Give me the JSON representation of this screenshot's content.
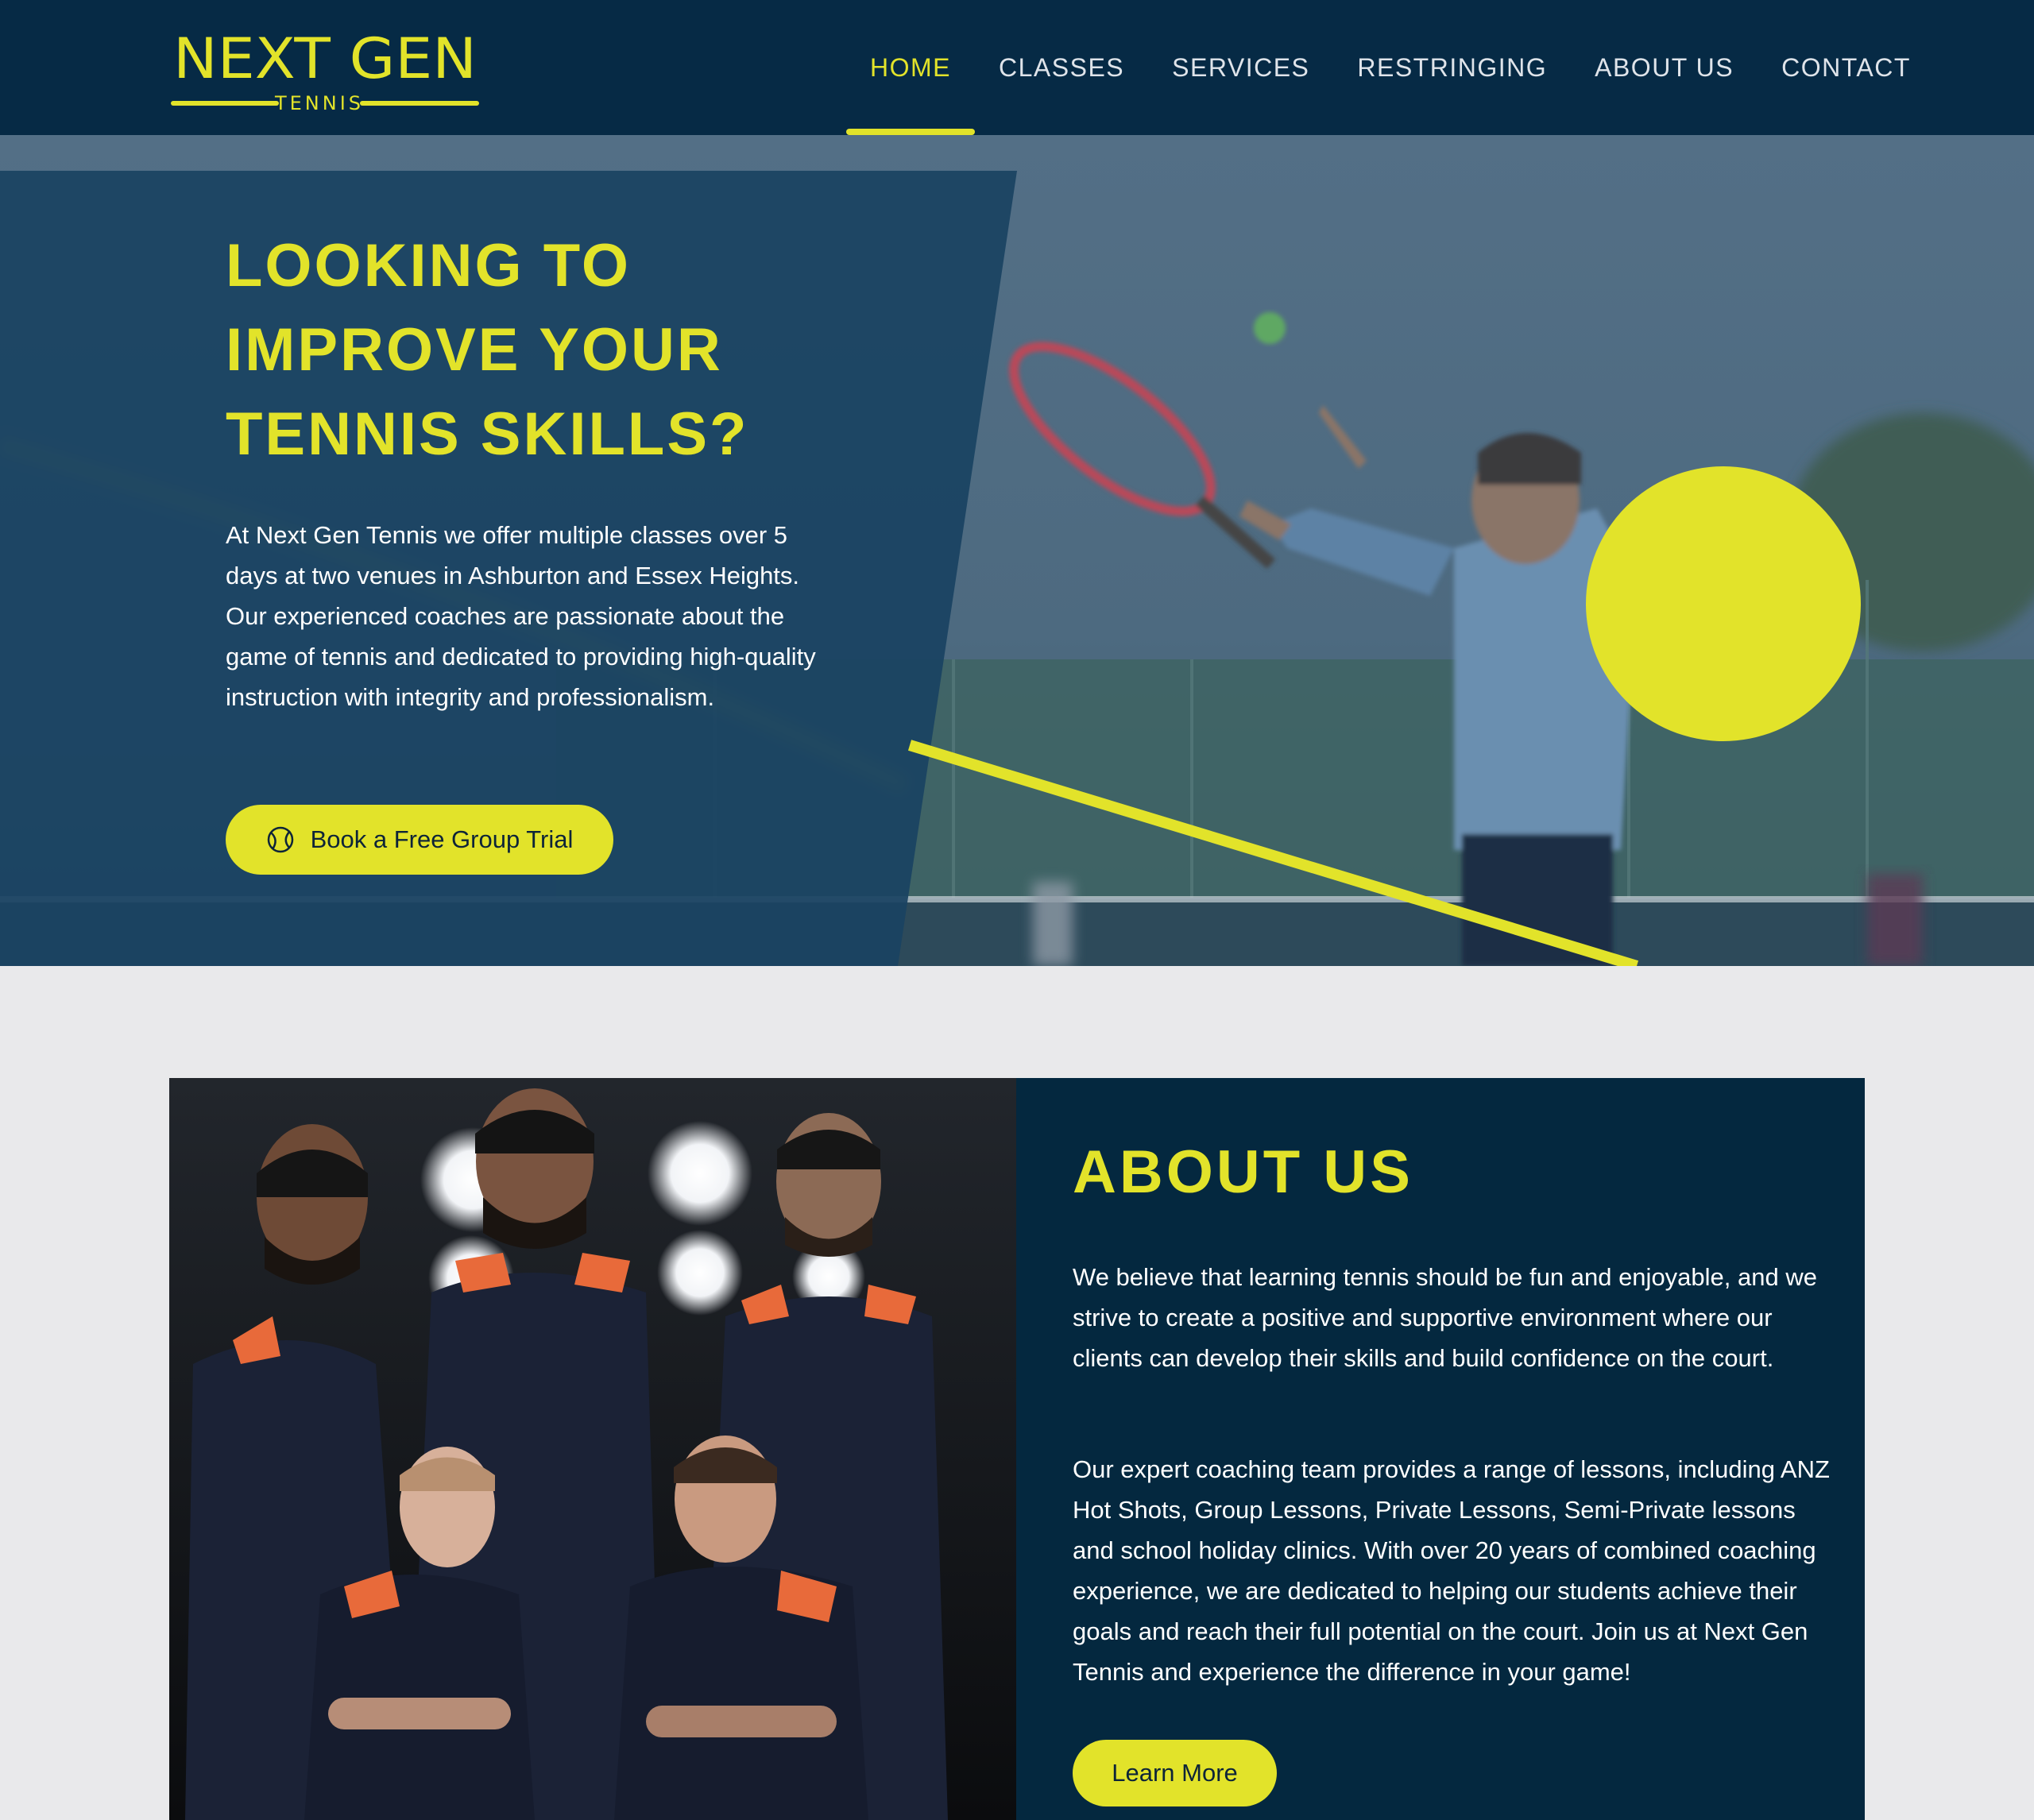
{
  "brand": {
    "logo_main": "NEXT GEN",
    "logo_sub": "TENNIS"
  },
  "nav": {
    "items": [
      {
        "label": "HOME",
        "active": true
      },
      {
        "label": "CLASSES",
        "active": false
      },
      {
        "label": "SERVICES",
        "active": false
      },
      {
        "label": "RESTRINGING",
        "active": false
      },
      {
        "label": "ABOUT US",
        "active": false
      },
      {
        "label": "CONTACT",
        "active": false
      }
    ]
  },
  "hero": {
    "title_lines": [
      "LOOKING TO",
      "IMPROVE YOUR",
      "TENNIS SKILLS?"
    ],
    "text": "At Next Gen Tennis we offer multiple classes over 5 days at two venues in Ashburton and Essex Heights. Our experienced coaches are passionate about the game of tennis and dedicated to providing high-quality instruction with integrity and professionalism.",
    "cta_label": "Book a Free Group Trial",
    "cta_icon": "tennis-ball-icon"
  },
  "about": {
    "title": "ABOUT US",
    "p1": "We believe that learning tennis should be fun and enjoyable, and we strive to create a positive and supportive environment where our clients can develop their skills and build confidence on the court.",
    "p2": "Our expert coaching team provides a range of lessons, including ANZ Hot Shots, Group Lessons, Private Lessons, Semi-Private lessons and school holiday clinics. With over 20 years of combined coaching experience, we are dedicated to helping our students achieve their goals and reach their full potential on the court. Join us at Next Gen Tennis and experience the difference in your game!",
    "button_label": "Learn More"
  },
  "colors": {
    "navy": "#062a45",
    "accent": "#e2e32a",
    "panel": "#1a4362",
    "background": "#e9e9eb"
  }
}
